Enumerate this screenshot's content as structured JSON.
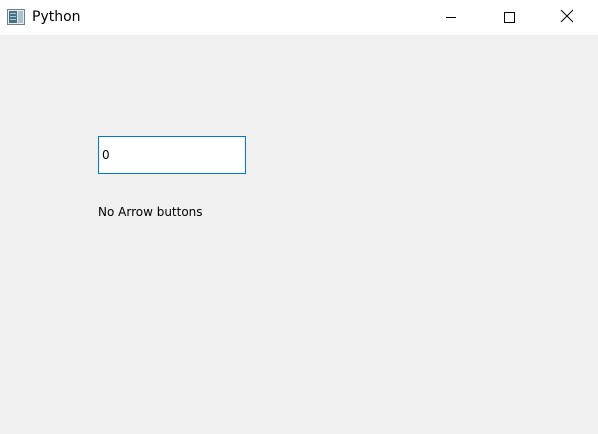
{
  "window": {
    "title": "Python",
    "icon": "python-app-icon",
    "controls": {
      "minimize": "minimize-icon",
      "maximize": "maximize-icon",
      "close": "close-icon"
    }
  },
  "main": {
    "spinbox": {
      "value": "0"
    },
    "label": "No Arrow buttons"
  },
  "colors": {
    "titlebar": "#ffffff",
    "client_area": "#f0f0f0",
    "focus_border": "#0078d7"
  }
}
